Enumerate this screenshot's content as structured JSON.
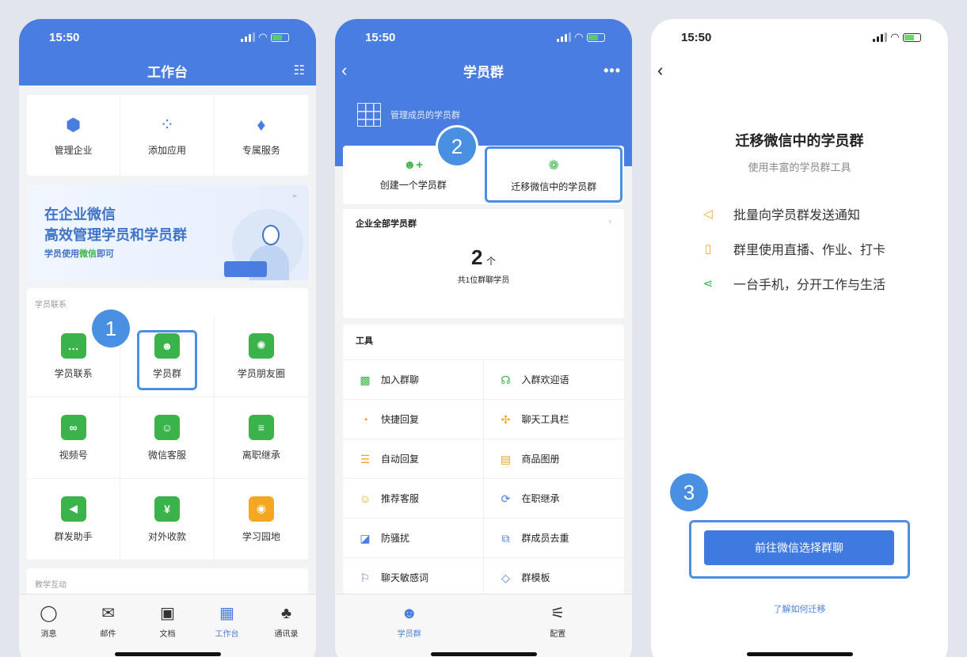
{
  "status": {
    "time": "15:50"
  },
  "screen1": {
    "title": "工作台",
    "top_items": [
      {
        "label": "管理企业",
        "icon": "hexagon-icon",
        "glyph": "⬢",
        "color": "#4a7de0"
      },
      {
        "label": "添加应用",
        "icon": "apps-add-icon",
        "glyph": "⁘",
        "color": "#4a7de0"
      },
      {
        "label": "专属服务",
        "icon": "tie-icon",
        "glyph": "♦",
        "color": "#4a7de0"
      }
    ],
    "banner": {
      "line1": "在企业微信",
      "line2": "高效管理学员和学员群",
      "sub_prefix": "学员使用",
      "sub_highlight": "微信",
      "sub_suffix": "即可"
    },
    "section1": "学员联系",
    "apps": [
      {
        "label": "学员联系",
        "icon": "chat-bubble-icon",
        "glyph": "…",
        "color": "#3ab44a"
      },
      {
        "label": "学员群",
        "icon": "group-icon",
        "glyph": "☻",
        "color": "#3ab44a"
      },
      {
        "label": "学员朋友圈",
        "icon": "aperture-icon",
        "glyph": "✺",
        "color": "#3ab44a"
      },
      {
        "label": "视频号",
        "icon": "video-channel-icon",
        "glyph": "∞",
        "color": "#3ab44a"
      },
      {
        "label": "微信客服",
        "icon": "service-icon",
        "glyph": "☺",
        "color": "#3ab44a"
      },
      {
        "label": "离职继承",
        "icon": "document-icon",
        "glyph": "≡",
        "color": "#3ab44a"
      },
      {
        "label": "群发助手",
        "icon": "megaphone-icon",
        "glyph": "◀",
        "color": "#3ab44a"
      },
      {
        "label": "对外收款",
        "icon": "yen-icon",
        "glyph": "¥",
        "color": "#3ab44a"
      },
      {
        "label": "学习园地",
        "icon": "planet-icon",
        "glyph": "◉",
        "color": "#f5a623"
      }
    ],
    "section2": "教学互动",
    "tabs": [
      {
        "label": "消息",
        "icon": "message-icon",
        "glyph": "◯"
      },
      {
        "label": "邮件",
        "icon": "mail-icon",
        "glyph": "✉"
      },
      {
        "label": "文档",
        "icon": "doc-icon",
        "glyph": "▣"
      },
      {
        "label": "工作台",
        "icon": "workbench-icon",
        "glyph": "▦",
        "active": true
      },
      {
        "label": "通讯录",
        "icon": "contacts-icon",
        "glyph": "♣"
      }
    ],
    "badge": "1"
  },
  "screen2": {
    "title": "学员群",
    "header_label": "管理成员的学员群",
    "actions": [
      {
        "label": "创建一个学员群",
        "icon": "add-group-icon",
        "glyph": "👥"
      },
      {
        "label": "迁移微信中的学员群",
        "icon": "wechat-icon",
        "glyph": "❁"
      }
    ],
    "all_groups_label": "企业全部学员群",
    "count": "2",
    "count_unit": "个",
    "count_sub": "共1位群聊学员",
    "tools_label": "工具",
    "tools": [
      {
        "label": "加入群聊",
        "icon": "qr-code-icon",
        "glyph": "▩",
        "color": "#3ab44a"
      },
      {
        "label": "入群欢迎语",
        "icon": "welcome-icon",
        "glyph": "☊",
        "color": "#3ab44a"
      },
      {
        "label": "快捷回复",
        "icon": "quick-reply-icon",
        "glyph": "◔",
        "color": "#f5a623"
      },
      {
        "label": "聊天工具栏",
        "icon": "toolbar-icon",
        "glyph": "✣",
        "color": "#f5a623"
      },
      {
        "label": "自动回复",
        "icon": "auto-reply-icon",
        "glyph": "☰",
        "color": "#f5a623"
      },
      {
        "label": "商品图册",
        "icon": "catalog-icon",
        "glyph": "▤",
        "color": "#f5a623"
      },
      {
        "label": "推荐客服",
        "icon": "recommend-icon",
        "glyph": "☺",
        "color": "#f5a623"
      },
      {
        "label": "在职继承",
        "icon": "transfer-icon",
        "glyph": "⟳",
        "color": "#4a7de0"
      },
      {
        "label": "防骚扰",
        "icon": "shield-icon",
        "glyph": "◪",
        "color": "#4a7de0"
      },
      {
        "label": "群成员去重",
        "icon": "dedupe-icon",
        "glyph": "⧉",
        "color": "#4a7de0"
      },
      {
        "label": "聊天敏感词",
        "icon": "sensitive-word-icon",
        "glyph": "⚐",
        "color": "#4a7de0"
      },
      {
        "label": "群模板",
        "icon": "template-icon",
        "glyph": "◇",
        "color": "#4a7de0"
      }
    ],
    "tabs": [
      {
        "label": "学员群",
        "icon": "group-tab-icon",
        "glyph": "☻",
        "active": true
      },
      {
        "label": "配置",
        "icon": "settings-sliders-icon",
        "glyph": "⚟"
      }
    ],
    "badge": "2"
  },
  "screen3": {
    "title": "迁移微信中的学员群",
    "subtitle": "使用丰富的学员群工具",
    "features": [
      {
        "label": "批量向学员群发送通知",
        "icon": "megaphone-icon",
        "glyph": "◁",
        "color": "#f5a623"
      },
      {
        "label": "群里使用直播、作业、打卡",
        "icon": "book-icon",
        "glyph": "▯",
        "color": "#f5a623"
      },
      {
        "label": "一台手机，分开工作与生活",
        "icon": "split-icon",
        "glyph": "⋖",
        "color": "#3ab44a"
      }
    ],
    "button": "前往微信选择群聊",
    "link": "了解如何迁移",
    "badge": "3"
  }
}
